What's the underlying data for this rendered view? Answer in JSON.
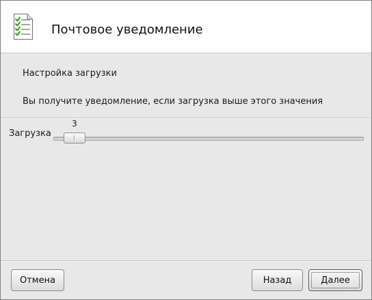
{
  "header": {
    "title": "Почтовое уведомление",
    "icon": "checklist-document-icon"
  },
  "content": {
    "subtitle": "Настройка загрузки",
    "description": "Вы получите уведомление, если загрузка выше этого значения"
  },
  "slider": {
    "label": "Загрузка",
    "value": "3",
    "min": 0,
    "max": 100
  },
  "buttons": {
    "cancel_label": "Отмена",
    "back_label": "Назад",
    "next_label": "Далее"
  },
  "colors": {
    "check_green": "#3c9a1e",
    "window_bg": "#e8e8e8",
    "header_bg": "#ffffff"
  }
}
